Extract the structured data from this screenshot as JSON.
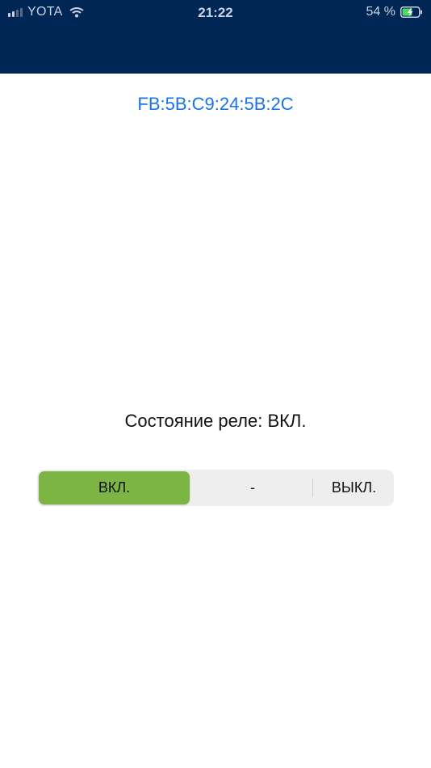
{
  "status_bar": {
    "carrier": "YOTA",
    "time": "21:22",
    "battery_percent": "54 %",
    "battery_level": 0.54,
    "icons": [
      "signal-icon",
      "wifi-icon",
      "battery-charging-icon"
    ]
  },
  "device": {
    "mac_address": "FB:5B:C9:24:5B:2C"
  },
  "relay": {
    "state_text": "Состояние реле: ВКЛ.",
    "segmented_control": {
      "options": [
        "ВКЛ.",
        "-",
        "ВЫКЛ."
      ],
      "selected": "ВКЛ."
    }
  },
  "colors": {
    "header": "#002655",
    "accent": "#1a73e8",
    "selected_segment": "#7db544"
  }
}
